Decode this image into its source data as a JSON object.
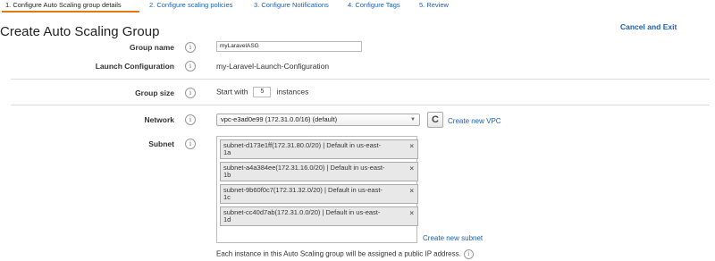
{
  "tabs": [
    {
      "label": "1. Configure Auto Scaling group details"
    },
    {
      "label": "2. Configure scaling policies"
    },
    {
      "label": "3. Configure Notifications"
    },
    {
      "label": "4. Configure Tags"
    },
    {
      "label": "5. Review"
    }
  ],
  "page_title": "Create Auto Scaling Group",
  "cancel_exit": "Cancel and Exit",
  "form": {
    "group_name_label": "Group name",
    "group_name_value": "myLaravelASG",
    "launch_config_label": "Launch Configuration",
    "launch_config_value": "my-Laravel-Launch-Configuration",
    "group_size_label": "Group size",
    "group_size_prefix": "Start with",
    "group_size_value": "5",
    "group_size_suffix": "instances",
    "network_label": "Network",
    "network_value": "vpc-e3ad0e99 (172.31.0.0/16) (default)",
    "create_vpc": "Create new VPC",
    "subnet_label": "Subnet",
    "subnets": [
      {
        "line1": "subnet-d173e1ff(172.31.80.0/20) | Default in us-east-",
        "line2": "1a"
      },
      {
        "line1": "subnet-a4a384ee(172.31.16.0/20) | Default in us-east-",
        "line2": "1b"
      },
      {
        "line1": "subnet-9b60f0c7(172.31.32.0/20) | Default in us-east-",
        "line2": "1c"
      },
      {
        "line1": "subnet-cc40d7ab(172.31.0.0/20) | Default in us-east-",
        "line2": "1d"
      }
    ],
    "create_subnet": "Create new subnet",
    "public_ip_note": "Each instance in this Auto Scaling group will be assigned a public IP address."
  },
  "help_glyph": "i",
  "remove_glyph": "×",
  "dropdown_glyph": "▼",
  "refresh_glyph": "C"
}
